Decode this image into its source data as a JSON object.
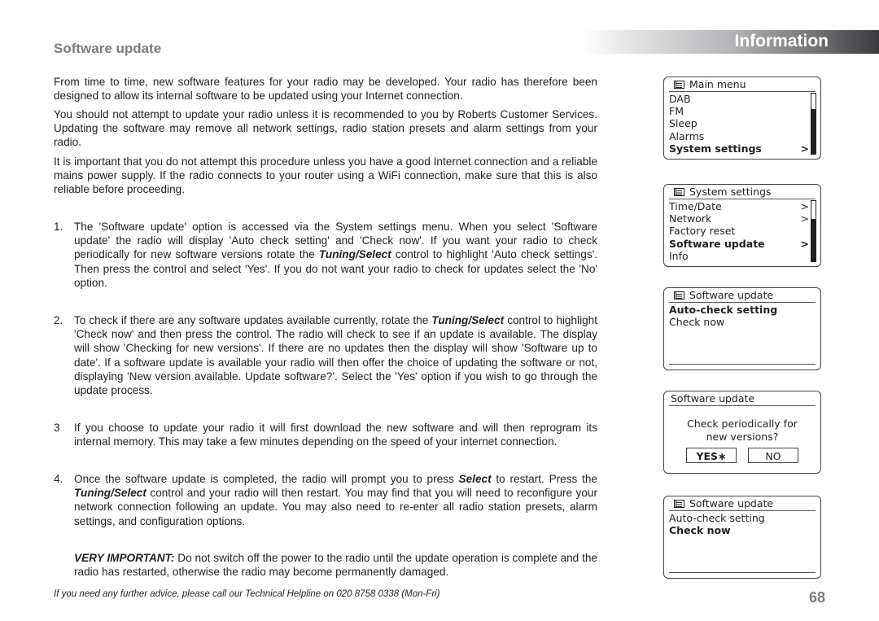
{
  "header": {
    "section_title": "Software update",
    "banner": "Information"
  },
  "intro": {
    "p1": "From time to time, new software features for your radio may be developed.  Your radio has therefore been designed to allow its internal software to be updated using your Internet connection.",
    "p2": "You should not attempt to update your radio unless it is recommended to you by Roberts Customer Services. Updating the software may remove all network settings, radio station presets and alarm settings from your radio.",
    "p3": "It is important that you do not attempt this procedure unless you have a good Internet connection and a reliable mains power supply. If the radio connects to your router using a WiFi connection, make sure that this is also reliable before proceeding."
  },
  "steps": [
    {
      "num": "1.",
      "a": "The 'Software update' option is accessed via the System settings menu. When you select 'Software update' the radio will display 'Auto check setting' and 'Check now'.  If you want your radio to check periodically for new software versions rotate the ",
      "b": "Tuning/Select",
      "c": " control to highlight 'Auto check settings'. Then press the control and select 'Yes'. If you do not want your radio to check for updates select the 'No' option."
    },
    {
      "num": "2.",
      "a": "To check if there are any software updates available currently, rotate the ",
      "b": "Tuning/Select",
      "c": " control to highlight 'Check now' and then press the control. The radio will check to see if an update is available. The display will show 'Checking for new versions'. If there are no updates then the display will show 'Software up to date'.  If a software update is available your radio will then offer the choice of updating the software or not, displaying 'New version available. Update software?'. Select the 'Yes' option if you wish to go through the update process."
    },
    {
      "num": "3",
      "a": "If you choose to update your radio it will first download the new software and will then reprogram its internal memory. This may take a few minutes depending on the speed of your internet connection."
    },
    {
      "num": "4.",
      "a": "Once the software update is completed, the radio will prompt you to press ",
      "b": "Select",
      "c": " to restart. Press the ",
      "d": "Tuning/Select",
      "e": " control and your radio will then restart.  You may find that you will need to reconfigure your network connection following an update. You may also need to re-enter all radio station presets, alarm settings, and configuration options."
    }
  ],
  "warning": {
    "label": "VERY IMPORTANT:",
    "text": " Do not switch off the power to the radio until the update operation is complete and the radio has restarted, otherwise the radio may become permanently damaged."
  },
  "footer": {
    "helpline": "If you need any further advice, please call our Technical Helpline on 020 8758 0338 (Mon-Fri)",
    "page_number": "68"
  },
  "screens": {
    "main_menu": {
      "title": "Main menu",
      "icon": "menu-list-icon",
      "items": [
        {
          "label": "DAB",
          "arrow": ""
        },
        {
          "label": "FM",
          "arrow": ""
        },
        {
          "label": "Sleep",
          "arrow": ""
        },
        {
          "label": "Alarms",
          "arrow": ""
        },
        {
          "label": "System settings",
          "arrow": ">",
          "selected": true
        }
      ],
      "scroll_position": 0.25
    },
    "system_settings": {
      "title": "System settings",
      "icon": "menu-list-icon",
      "items": [
        {
          "label": "Time/Date",
          "arrow": ">"
        },
        {
          "label": "Network",
          "arrow": ">"
        },
        {
          "label": "Factory reset",
          "arrow": ""
        },
        {
          "label": "Software update",
          "arrow": ">",
          "selected": true
        },
        {
          "label": "Info",
          "arrow": ""
        }
      ],
      "scroll_position": 0.3
    },
    "software_update_1": {
      "title": "Software update",
      "icon": "menu-list-icon",
      "items": [
        {
          "label": "Auto-check setting",
          "selected": true
        },
        {
          "label": "Check now"
        }
      ]
    },
    "auto_check_prompt": {
      "title": "Software update",
      "prompt_line1": "Check periodically for",
      "prompt_line2": "new versions?",
      "yes_label": "YES",
      "yes_marker": "∗",
      "no_label": "NO"
    },
    "software_update_2": {
      "title": "Software update",
      "icon": "menu-list-icon",
      "items": [
        {
          "label": "Auto-check setting"
        },
        {
          "label": "Check now",
          "selected": true
        }
      ]
    }
  }
}
